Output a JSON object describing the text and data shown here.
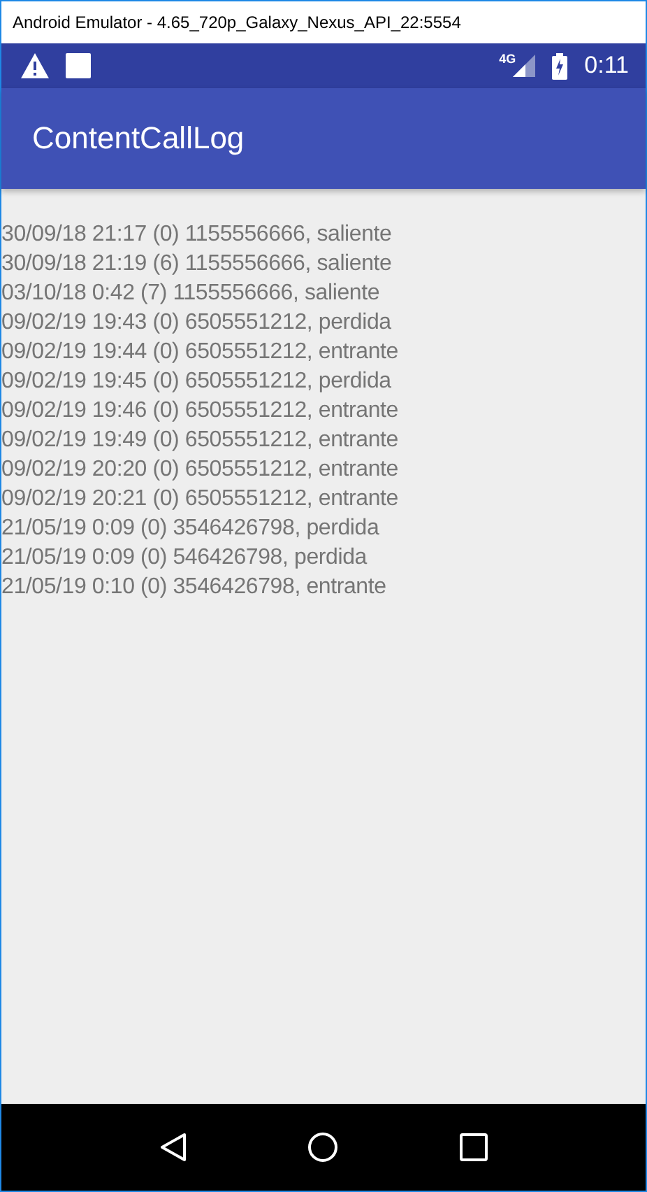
{
  "window": {
    "title": "Android Emulator - 4.65_720p_Galaxy_Nexus_API_22:5554"
  },
  "status_bar": {
    "network": "4G",
    "time": "0:11"
  },
  "app_bar": {
    "title": "ContentCallLog"
  },
  "call_log": [
    "30/09/18 21:17 (0) 1155556666, saliente",
    "30/09/18 21:19 (6) 1155556666, saliente",
    "03/10/18 0:42 (7) 1155556666, saliente",
    "09/02/19 19:43 (0) 6505551212, perdida",
    "09/02/19 19:44 (0) 6505551212, entrante",
    "09/02/19 19:45 (0) 6505551212, perdida",
    "09/02/19 19:46 (0) 6505551212, entrante",
    "09/02/19 19:49 (0) 6505551212, entrante",
    "09/02/19 20:20 (0) 6505551212, entrante",
    "09/02/19 20:21 (0) 6505551212, entrante",
    "21/05/19 0:09 (0) 3546426798, perdida",
    "21/05/19 0:09 (0) 546426798, perdida",
    "21/05/19 0:10 (0) 3546426798, entrante"
  ]
}
